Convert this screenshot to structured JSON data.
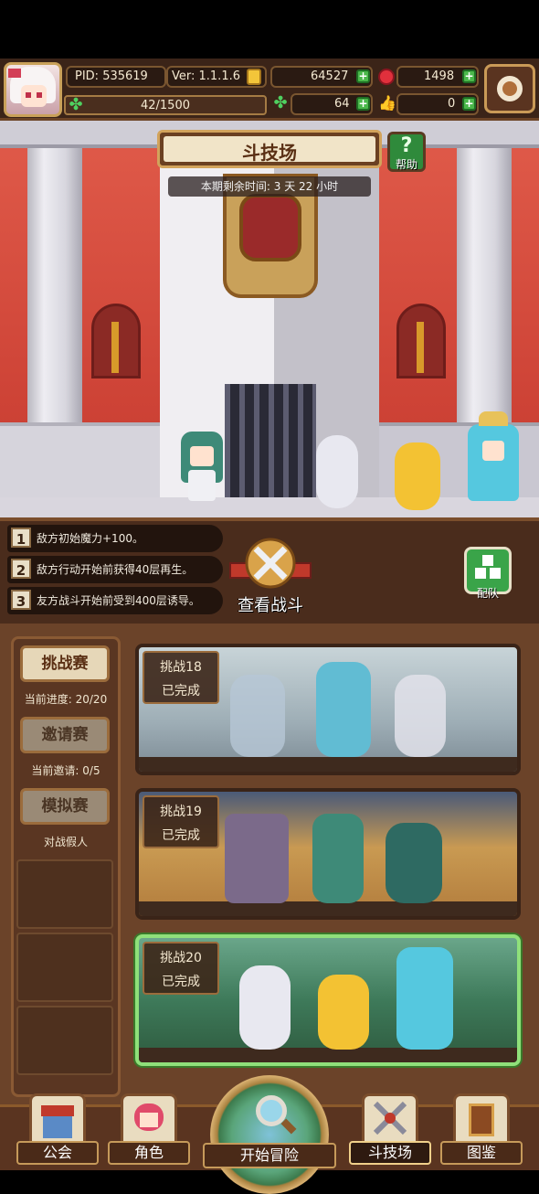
{
  "header": {
    "pid": "PID: 535619",
    "version": "Ver: 1.1.1.6",
    "xp": "42/1500",
    "gold": "64527",
    "gems": "1498",
    "clovers": "64",
    "likes": "0"
  },
  "arena": {
    "title": "斗技场",
    "help_label": "帮助",
    "help_glyph": "?",
    "time_remaining": "本期剩余时间: 3 天 22 小时"
  },
  "rules": [
    {
      "num": "1",
      "text": "敌方初始魔力+100。"
    },
    {
      "num": "2",
      "text": "敌方行动开始前获得40层再生。"
    },
    {
      "num": "3",
      "text": "友方战斗开始前受到400层诱导。"
    }
  ],
  "actions": {
    "view_battle": "查看战斗",
    "team": "配队"
  },
  "sidebar": {
    "challenge": {
      "label": "挑战赛",
      "sub": "当前进度: 20/20"
    },
    "invite": {
      "label": "邀请赛",
      "sub": "当前邀请: 0/5"
    },
    "simulate": {
      "label": "模拟赛",
      "sub": "对战假人"
    }
  },
  "cards": [
    {
      "title": "挑战18",
      "status": "已完成"
    },
    {
      "title": "挑战19",
      "status": "已完成"
    },
    {
      "title": "挑战20",
      "status": "已完成"
    }
  ],
  "nav": {
    "guild": "公会",
    "character": "角色",
    "adventure": "开始冒险",
    "arena": "斗技场",
    "codex": "图鉴"
  },
  "icons": {
    "gold": "coin-icon",
    "gem": "apple-icon",
    "clover": "clover-icon",
    "like": "thumbs-up-icon",
    "settings": "gear-icon"
  },
  "colors": {
    "accent": "#c9a15a",
    "plus": "#4bb84b",
    "selected_card": "#8fe07a"
  }
}
